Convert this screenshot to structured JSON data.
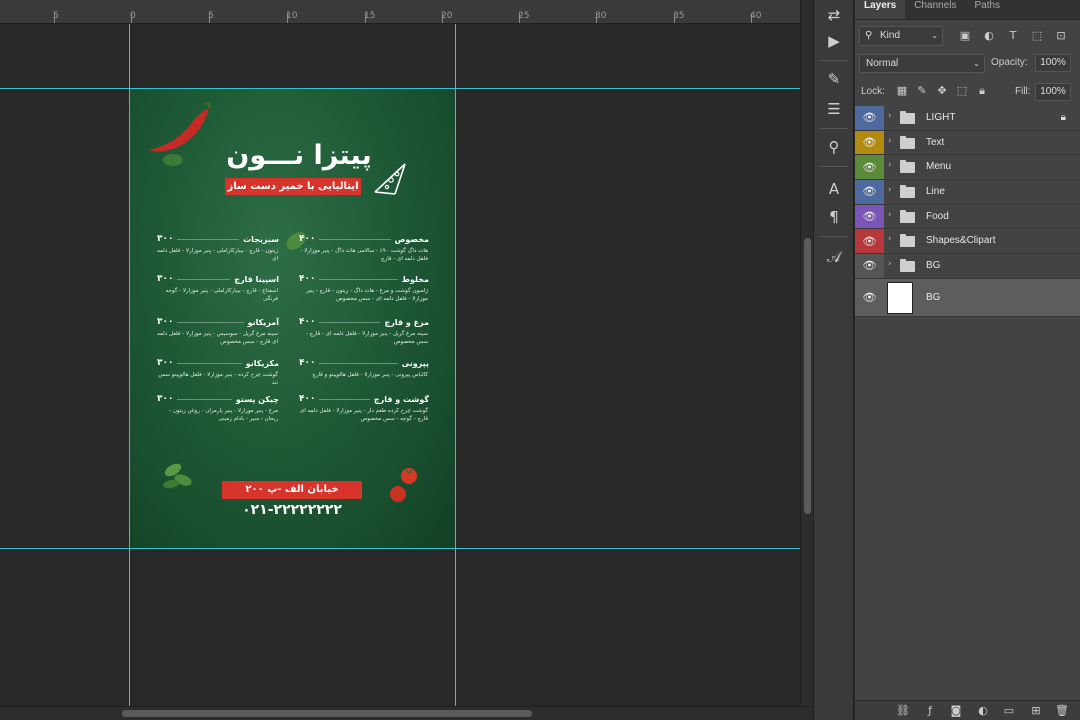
{
  "ruler": {
    "labels": [
      "5",
      "0",
      "5",
      "10",
      "15",
      "20",
      "25",
      "30",
      "35",
      "40"
    ]
  },
  "poster": {
    "title": "پیتزا نـــون",
    "subtitle": "ایتالیایی با خمیر دست ساز",
    "address": "خیابان الف -پ ۲۰۰",
    "phone": "۰۲۱-۲۲۲۲۲۲۲۲",
    "right_column": [
      {
        "name": "مخصوص",
        "price": "۴۰۰",
        "desc": "هات داگ گوشت ۹۰٪ - سالامی هات داگ - پنیر موزارلا - فلفل دلمه ای - قارچ"
      },
      {
        "name": "مخلوط",
        "price": "۴۰۰",
        "desc": "ژامبون گوشت و مرغ - هات داگ - زیتون - قارچ - پنیر موزارلا - فلفل دلمه ای - سس مخصوص"
      },
      {
        "name": "مرغ و قارچ",
        "price": "۴۰۰",
        "desc": "سینه مرغ گریل - پنیر موزارلا - فلفل دلمه ای - قارچ - سس مخصوص"
      },
      {
        "name": "پپرونی",
        "price": "۴۰۰",
        "desc": "کالباس پپرونی - پنیر موزارلا - فلفل هالوپینو و قارچ"
      },
      {
        "name": "گوشت و قارچ",
        "price": "۴۰۰",
        "desc": "گوشت چرخ کرده طعم دار - پنیر موزارلا - فلفل دلمه ای قارچ - گوجه - سس مخصوص"
      }
    ],
    "left_column": [
      {
        "name": "سبزیجات",
        "price": "۳۰۰",
        "desc": "زیتون - قارچ - بیبارکاراملی - پنیر موزارلا - فلفل دلمه ای"
      },
      {
        "name": "اسپینا قارچ",
        "price": "۳۰۰",
        "desc": "اسفناج - قارچ - بیبارکاراملی - پنیر موزارلا - گوجه فرنگی"
      },
      {
        "name": "آمریکانو",
        "price": "۳۰۰",
        "desc": "سینه مرغ گریل - سوسیس - پنیر موزارلا - فلفل دلمه ای قارچ - سس مخصوص"
      },
      {
        "name": "مکزیکانو",
        "price": "۳۰۰",
        "desc": "گوشت چرخ کرده - پنیر موزارلا - فلفل هالوپینو سس تند"
      },
      {
        "name": "چیکن پستو",
        "price": "۳۰۰",
        "desc": "مرغ - پنیر موزارلا - پنیر پارمزان - روغن زیتون - ریحان - سیر - بادام زمینی"
      }
    ]
  },
  "layers_panel": {
    "tabs": [
      "Layers",
      "Channels",
      "Paths"
    ],
    "kind_filter": "Kind",
    "blend_mode": "Normal",
    "opacity_label": "Opacity:",
    "opacity_value": "100%",
    "lock_label": "Lock:",
    "fill_label": "Fill:",
    "fill_value": "100%",
    "layers": [
      {
        "name": "LIGHT",
        "color": "#4e6a9e",
        "locked": true
      },
      {
        "name": "Text",
        "color": "#b08b10"
      },
      {
        "name": "Menu",
        "color": "#5a8a3a"
      },
      {
        "name": "Line",
        "color": "#4e6a9e"
      },
      {
        "name": "Food",
        "color": "#7a55b5"
      },
      {
        "name": "Shapes&Clipart",
        "color": "#b5383a"
      },
      {
        "name": "BG",
        "color": "#555555"
      }
    ],
    "background_layer": "BG"
  },
  "colors": {
    "guide": "#35c5cf",
    "accent_red": "#d7342b",
    "poster_green": "#1f5a37"
  }
}
